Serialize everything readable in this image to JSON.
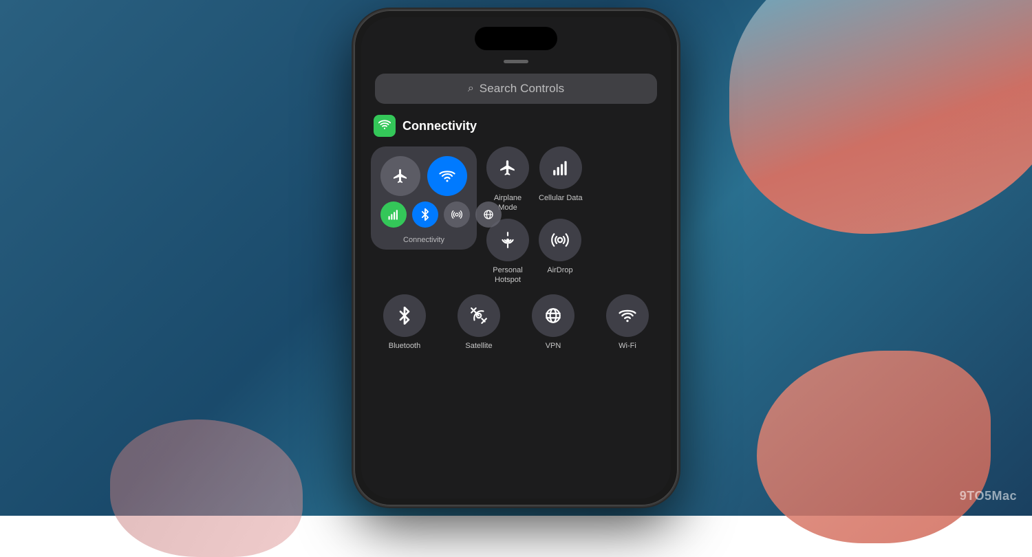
{
  "background": {
    "color_main": "#1a4a6b",
    "color_accent": "#e07060"
  },
  "watermark": {
    "text": "9TO5Mac"
  },
  "search": {
    "placeholder": "Search Controls",
    "icon": "🔍"
  },
  "connectivity_section": {
    "title": "Connectivity",
    "icon_color": "#34c759",
    "icon_symbol": "📡"
  },
  "controls": {
    "connectivity_widget": {
      "label": "Connectivity",
      "airplane_icon": "✈",
      "wifi_icon": "📶",
      "cellular_icon": "📊",
      "bluetooth_icon": "⬡",
      "airdrop_icon": "⊙",
      "vpn_icon": "⊕"
    },
    "airplane_mode": {
      "label": "Airplane Mode",
      "icon": "✈"
    },
    "cellular_data": {
      "label": "Cellular Data",
      "icon": "📶"
    },
    "personal_hotspot": {
      "label": "Personal Hotspot",
      "icon": "⊙"
    },
    "airdrop": {
      "label": "AirDrop",
      "icon": "📡"
    },
    "bluetooth": {
      "label": "Bluetooth",
      "icon": "⬡"
    },
    "satellite": {
      "label": "Satellite",
      "icon": "📡"
    },
    "vpn": {
      "label": "VPN",
      "icon": "🌐"
    },
    "wifi": {
      "label": "Wi-Fi",
      "icon": "📶"
    }
  }
}
